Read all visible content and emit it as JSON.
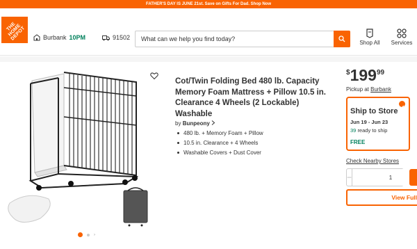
{
  "promo": {
    "text": "FATHER'S DAY IS JUNE 21st. Save on Gifts For Dad. Shop Now"
  },
  "colors": {
    "brand_orange": "#f96302",
    "success_green": "#00805c",
    "text": "#333333"
  },
  "header": {
    "logo": {
      "text": "THE HOME DEPOT"
    },
    "store": {
      "name": "Burbank",
      "hours": "10PM",
      "icon": "store-icon"
    },
    "delivery": {
      "zip": "91502",
      "icon": "truck-icon"
    },
    "search": {
      "placeholder": "What can we help you find today?",
      "value": "",
      "icon": "search-icon"
    },
    "nav": [
      {
        "label": "Shop All",
        "icon": "shop-all-icon"
      },
      {
        "label": "Services",
        "icon": "services-icon"
      }
    ]
  },
  "gallery": {
    "image_alt": "Cot/Twin folding bed with memory foam mattress, pillow and cover",
    "favorite_icon": "heart-icon",
    "page_count": 3,
    "active_page": 1
  },
  "product": {
    "title": "Cot/Twin Folding Bed 480 lb. Capacity Memory Foam Mattress + Pillow 10.5 in. Clearance 4 Wheels (2 Lockable) Washable",
    "brand_prefix": "by",
    "brand": "Bunpeony",
    "bullets": [
      "480 lb. + Memory Foam + Pillow",
      "10.5 in. Clearance + 4 Wheels",
      "Washable Covers + Dust Cover"
    ]
  },
  "buybox": {
    "price": {
      "currency": "$",
      "dollars": "199",
      "cents": "99"
    },
    "pickup": {
      "prefix": "Pickup at",
      "store": "Burbank"
    },
    "ship": {
      "title": "Ship to Store",
      "dates": "Jun 19 - Jun 23",
      "stock_qty": "39",
      "stock_suffix": "ready to ship",
      "cost": "FREE"
    },
    "nearby_link": "Check Nearby Stores",
    "quantity": {
      "value": "1",
      "minus": "−",
      "plus": "+"
    },
    "view_full_label": "View Full"
  }
}
